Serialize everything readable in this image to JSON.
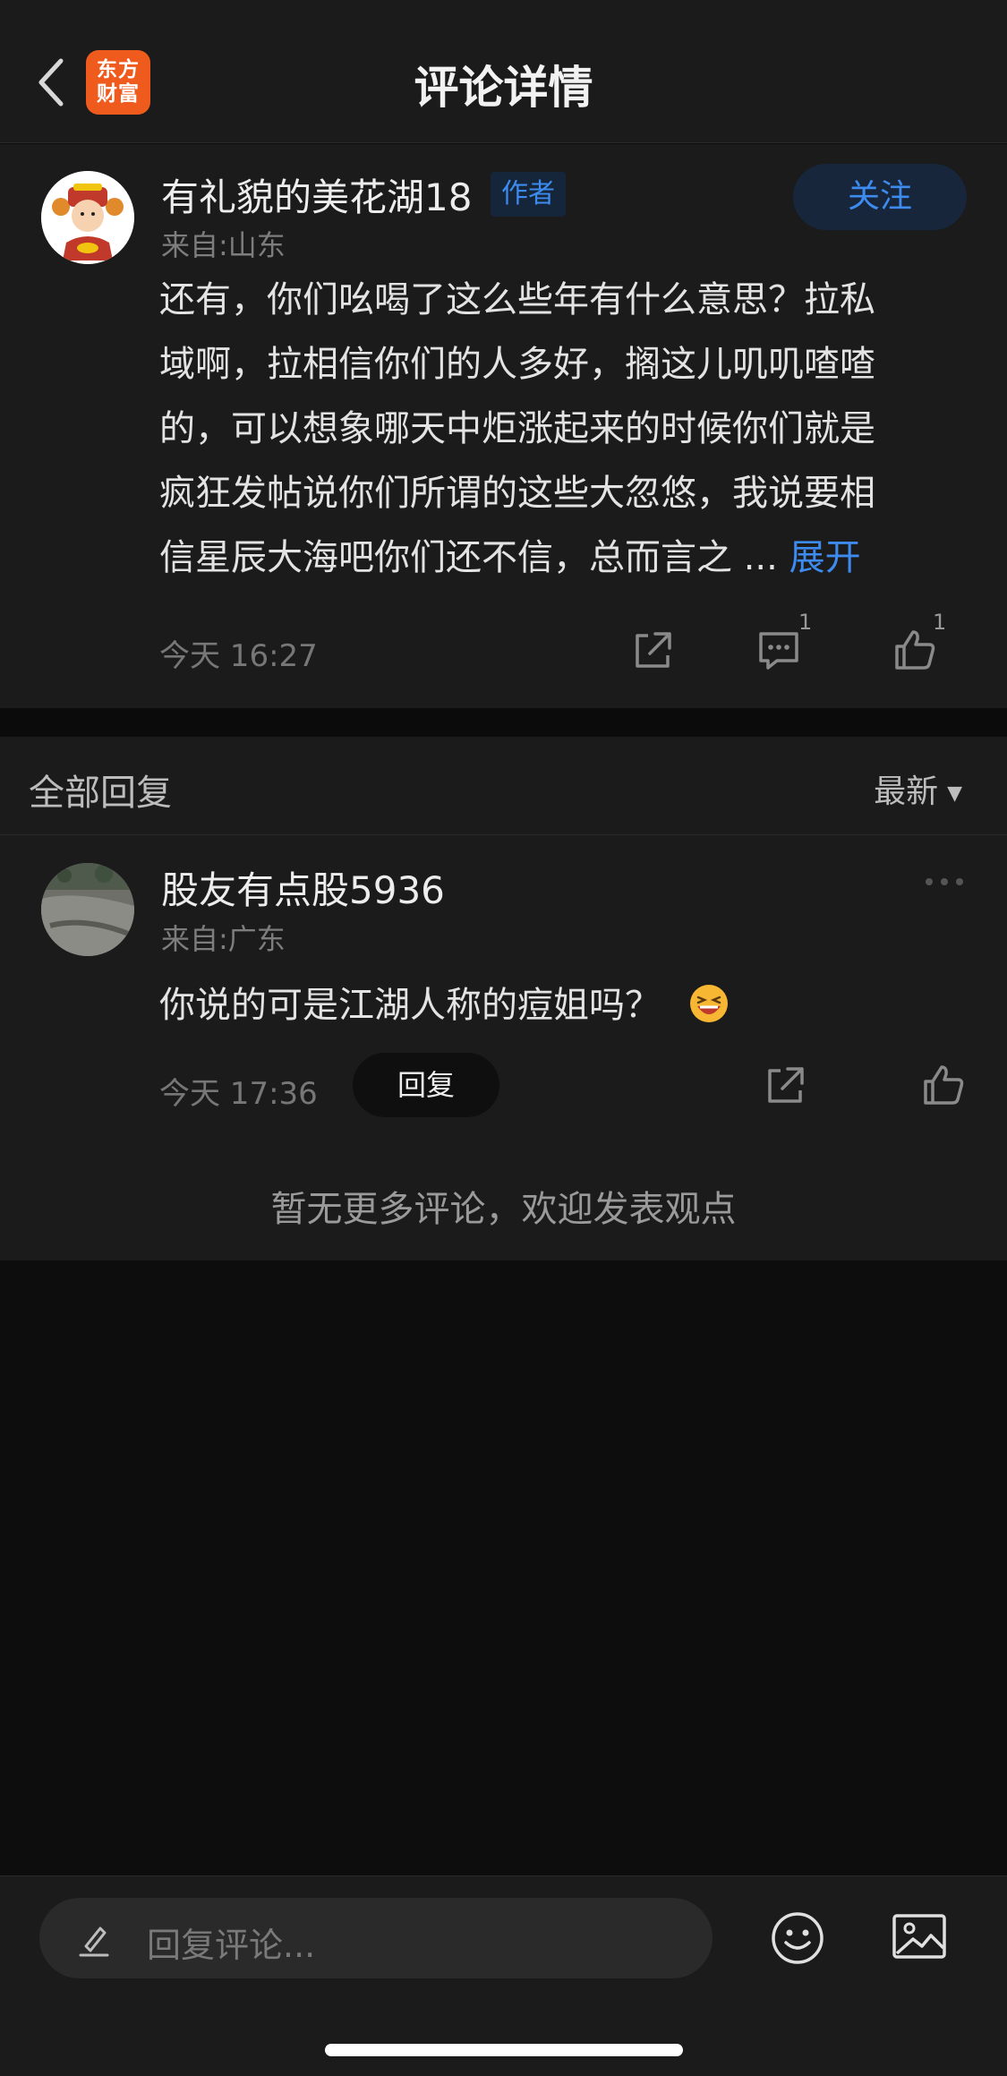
{
  "header": {
    "logo_line1": "东方",
    "logo_line2": "财富",
    "title": "评论详情"
  },
  "main_comment": {
    "username": "有礼貌的美花湖18",
    "author_badge": "作者",
    "follow_label": "关注",
    "location": "来自:山东",
    "content_lines": [
      "还有，你们吆喝了这么些年有什么意思？拉私",
      "域啊，拉相信你们的人多好，搁这儿叽叽喳喳",
      "的，可以想象哪天中炬涨起来的时候你们就是",
      "疯狂发帖说你们所谓的这些大忽悠，我说要相",
      "信星辰大海吧你们还不信，总而言之 ... "
    ],
    "expand_label": "展开",
    "time": "今天 16:27",
    "comment_count": "1",
    "like_count": "1"
  },
  "replies": {
    "title": "全部回复",
    "sort_label": "最新",
    "items": [
      {
        "username": "股友有点股5936",
        "location": "来自:广东",
        "text": "你说的可是江湖人称的痘姐吗？",
        "time": "今天 17:36",
        "reply_label": "回复"
      }
    ],
    "no_more": "暂无更多评论，欢迎发表观点"
  },
  "bottom_bar": {
    "input_placeholder": "回复评论..."
  },
  "colors": {
    "background": "#0d0d0d",
    "panel": "#1b1b1b",
    "accent_blue": "#3d8bef",
    "brand_orange": "#ef5a1d"
  }
}
